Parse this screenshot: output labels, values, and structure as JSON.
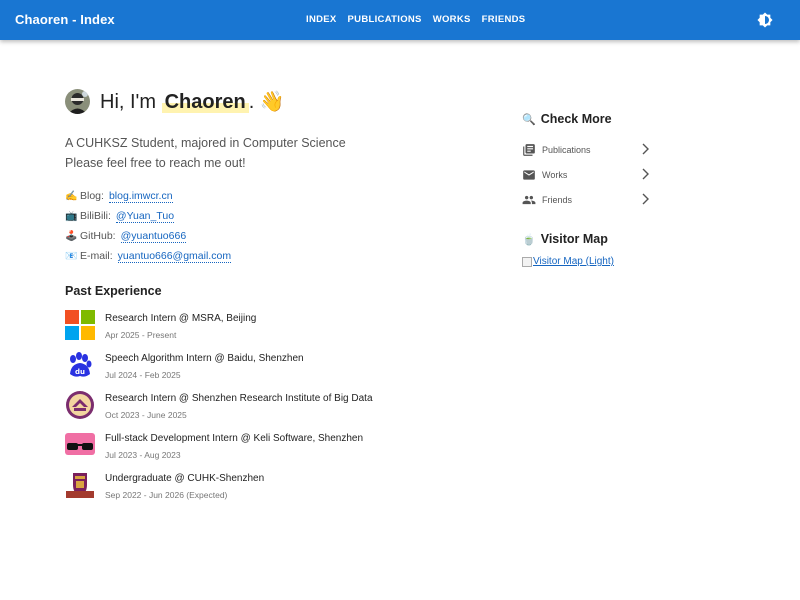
{
  "appbar": {
    "title": "Chaoren - Index",
    "nav": [
      "INDEX",
      "PUBLICATIONS",
      "WORKS",
      "FRIENDS"
    ],
    "theme_toggle_icon": "brightness-icon",
    "color": "#1976d2"
  },
  "hero": {
    "greeting_prefix": "Hi, I'm",
    "name": "Chaoren",
    "greeting_suffix": ".",
    "wave": "👋"
  },
  "intro": {
    "line1": "A CUHKSZ Student, majored in Computer Science",
    "line2": "Please feel free to reach me out!"
  },
  "contacts": [
    {
      "emoji": "✍️",
      "label": "Blog:",
      "value": "blog.imwcr.cn"
    },
    {
      "emoji": "📺",
      "label": "BiliBili:",
      "value": "@Yuan_Tuo"
    },
    {
      "emoji": "🕹️",
      "label": "GitHub:",
      "value": "@yuantuo666"
    },
    {
      "emoji": "📧",
      "label": "E-mail:",
      "value": "yuantuo666@gmail.com"
    }
  ],
  "experience": {
    "title": "Past Experience",
    "items": [
      {
        "logo": "microsoft-logo",
        "role": "Research Intern @ MSRA, Beijing",
        "date": "Apr 2025 - Present"
      },
      {
        "logo": "baidu-logo",
        "role": "Speech Algorithm Intern @ Baidu, Shenzhen",
        "date": "Jul 2024 - Feb 2025"
      },
      {
        "logo": "sribd-logo",
        "role": "Research Intern @ Shenzhen Research Institute of Big Data",
        "date": "Oct 2023 - June 2025"
      },
      {
        "logo": "keli-logo",
        "role": "Full-stack Development Intern @ Keli Software, Shenzhen",
        "date": "Jul 2023 - Aug 2023"
      },
      {
        "logo": "cuhk-logo",
        "role": "Undergraduate @ CUHK-Shenzhen",
        "date": "Sep 2022 - Jun 2026 (Expected)"
      }
    ]
  },
  "sidebar": {
    "check_more": {
      "emoji": "🔍",
      "title": "Check More"
    },
    "items": [
      {
        "icon": "library-books-icon",
        "label": "Publications"
      },
      {
        "icon": "mail-icon",
        "label": "Works"
      },
      {
        "icon": "people-icon",
        "label": "Friends"
      }
    ],
    "visitor": {
      "emoji": "🍵",
      "title": "Visitor Map",
      "image_alt": "Visitor Map (Light)"
    }
  }
}
